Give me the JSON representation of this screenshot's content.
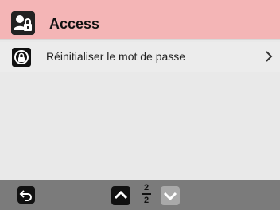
{
  "header": {
    "title": "Access",
    "icon": "user-lock-icon",
    "background_color": "#f4b5b6"
  },
  "list": {
    "items": [
      {
        "label": "Réinitialiser le mot de passe",
        "icon": "reset-password-icon"
      }
    ]
  },
  "footer": {
    "background_color": "#7b7b7b",
    "page_indicator": {
      "current": "2",
      "total": "2"
    }
  }
}
